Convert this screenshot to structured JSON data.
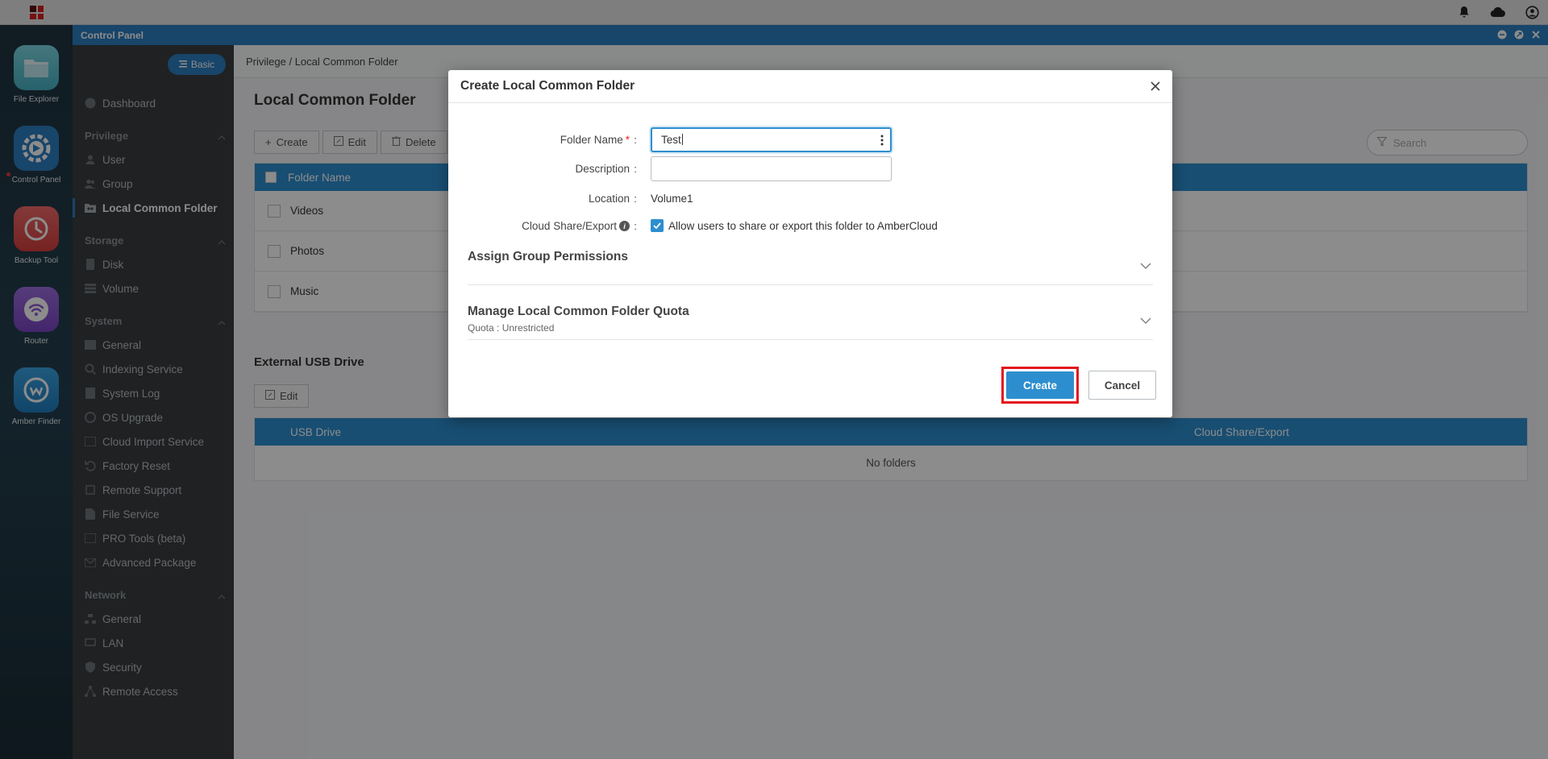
{
  "topbar": {
    "icons": [
      "bell-icon",
      "cloud-icon",
      "user-icon"
    ]
  },
  "dock": {
    "apps": [
      {
        "label": "File Explorer",
        "icon": "folder-icon",
        "color": "#5fc8d6"
      },
      {
        "label": "Control Panel",
        "icon": "gear-icon",
        "color": "#2d7fc1"
      },
      {
        "label": "Backup Tool",
        "icon": "clock-icon",
        "color": "#e24f4f"
      },
      {
        "label": "Router",
        "icon": "wifi-icon",
        "color": "#8d5ad1"
      },
      {
        "label": "Amber Finder",
        "icon": "finder-icon",
        "color": "#2a8fd4"
      }
    ]
  },
  "window": {
    "title": "Control Panel"
  },
  "sidebar": {
    "mode_label": "Basic",
    "dashboard": "Dashboard",
    "sections": {
      "privilege": "Privilege",
      "storage": "Storage",
      "system": "System",
      "network": "Network"
    },
    "privilege_items": [
      "User",
      "Group",
      "Local Common Folder"
    ],
    "storage_items": [
      "Disk",
      "Volume"
    ],
    "system_items": [
      "General",
      "Indexing Service",
      "System Log",
      "OS Upgrade",
      "Cloud Import Service",
      "Factory Reset",
      "Remote Support",
      "File Service",
      "PRO Tools (beta)",
      "Advanced Package"
    ],
    "network_items": [
      "General",
      "LAN",
      "Security",
      "Remote Access"
    ]
  },
  "main": {
    "breadcrumb": "Privilege / Local Common Folder",
    "title": "Local Common Folder",
    "toolbar": {
      "create": "Create",
      "edit": "Edit",
      "delete": "Delete"
    },
    "search_placeholder": "Search",
    "table": {
      "header": "Folder Name",
      "rows": [
        "Videos",
        "Photos",
        "Music"
      ]
    },
    "usb": {
      "title": "External USB Drive",
      "edit": "Edit",
      "col_drive": "USB Drive",
      "col_cloud": "Cloud Share/Export",
      "empty": "No folders"
    }
  },
  "dialog": {
    "title": "Create Local Common Folder",
    "folder_name_label": "Folder Name",
    "folder_name_value": "Test",
    "description_label": "Description",
    "description_value": "",
    "location_label": "Location",
    "location_value": "Volume1",
    "cloud_label": "Cloud Share/Export",
    "cloud_checkbox_label": "Allow users to share or export this folder to AmberCloud",
    "cloud_checked": true,
    "assign_title": "Assign Group Permissions",
    "quota_title": "Manage Local Common Folder Quota",
    "quota_sub": "Quota : Unrestricted",
    "create_btn": "Create",
    "cancel_btn": "Cancel"
  },
  "colors": {
    "accent": "#2d8ecf",
    "highlight": "#e3161e"
  }
}
